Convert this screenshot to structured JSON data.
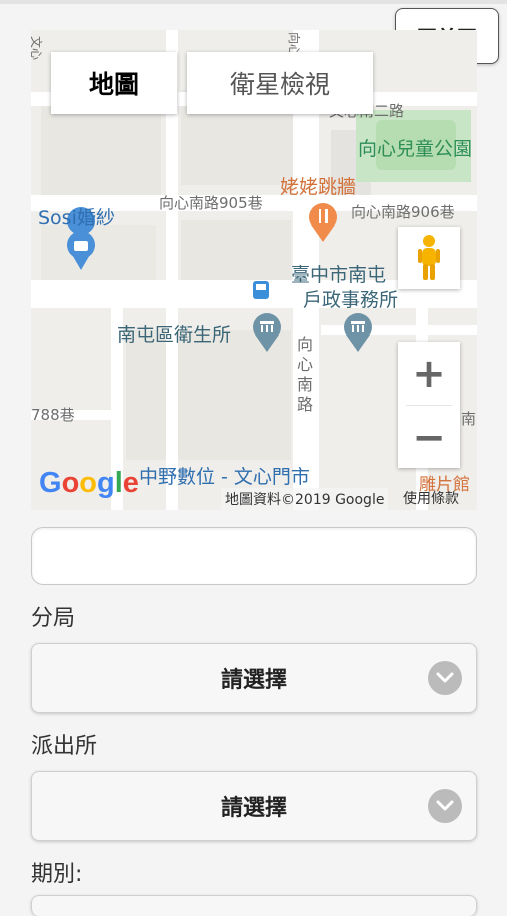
{
  "header": {
    "home_label": "回首頁"
  },
  "map": {
    "tabs": [
      {
        "label": "地圖"
      },
      {
        "label": "衛星檢視"
      }
    ],
    "labels": {
      "xin_south_2": "文心南二路",
      "children_park": "向心兒童公園",
      "restaurant": "姥姥跳牆",
      "lane905": "向心南路905巷",
      "lane906": "向心南路906巷",
      "wedding": "Sosi婚紗",
      "household_office_1": "臺中市南屯",
      "household_office_2": "戶政事務所",
      "health_center": "南屯區衛生所",
      "xinxin_south_road": "向心南路",
      "lane788": "788巷",
      "zhongye": "中野數位 - 文心門市",
      "left_top_road": "文心",
      "top_road": "向心",
      "right_fragment": "南",
      "bottom_right_poi": "雕片館"
    },
    "google_logo": "Google",
    "copyright": "地圖資料©2019 Google",
    "terms": "使用條款",
    "zoom_in": "+",
    "zoom_out": "−"
  },
  "form": {
    "name_value": "",
    "branch_label": "分局",
    "branch_selected": "請選擇",
    "station_label": "派出所",
    "station_selected": "請選擇",
    "period_label": "期別:"
  },
  "icons": {
    "pegman": "pegman-icon",
    "chevron": "chevron-down-icon"
  },
  "colors": {
    "poi_blue": "#2f6fb0",
    "poi_orange": "#d3723b",
    "park_green": "#2e8f56"
  }
}
